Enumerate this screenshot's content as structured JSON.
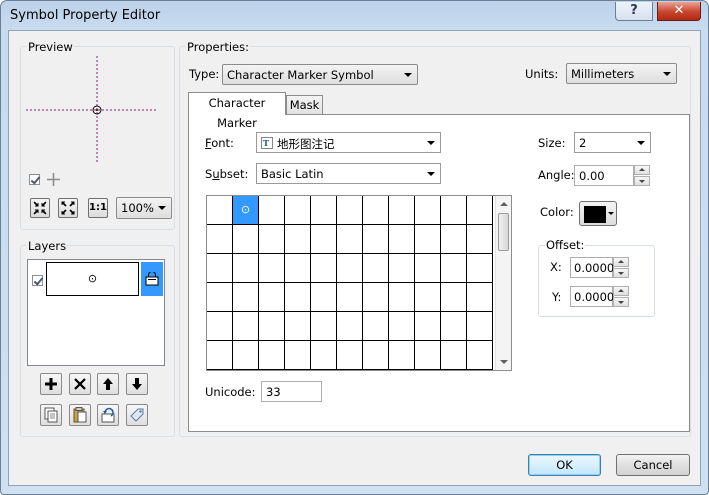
{
  "window": {
    "title": "Symbol Property Editor",
    "help": "?",
    "close": "✕"
  },
  "preview": {
    "label": "Preview",
    "zoom": "100%"
  },
  "layers": {
    "label": "Layers",
    "preview_glyph": "⊙"
  },
  "properties": {
    "label": "Properties:",
    "type_label": "Type:",
    "type_value": "Character Marker Symbol",
    "units_label": "Units:",
    "units_value": "Millimeters"
  },
  "tabs": [
    {
      "label": "Character Marker"
    },
    {
      "label": "Mask"
    }
  ],
  "charmarker": {
    "font_label": "Font:",
    "font_value": "地形图注记",
    "subset_label": "Subset:",
    "subset_value": "Basic Latin",
    "selected_glyph": "⊙",
    "unicode_label": "Unicode:",
    "unicode_value": "33",
    "size_label": "Size:",
    "size_value": "2",
    "angle_label": "Angle:",
    "angle_value": "0.00",
    "color_label": "Color:",
    "color_value": "#000000",
    "offset_label": "Offset:",
    "x_label": "X:",
    "x_value": "0.0000",
    "y_label": "Y:",
    "y_value": "0.0000"
  },
  "buttons": {
    "ok": "OK",
    "cancel": "Cancel"
  }
}
